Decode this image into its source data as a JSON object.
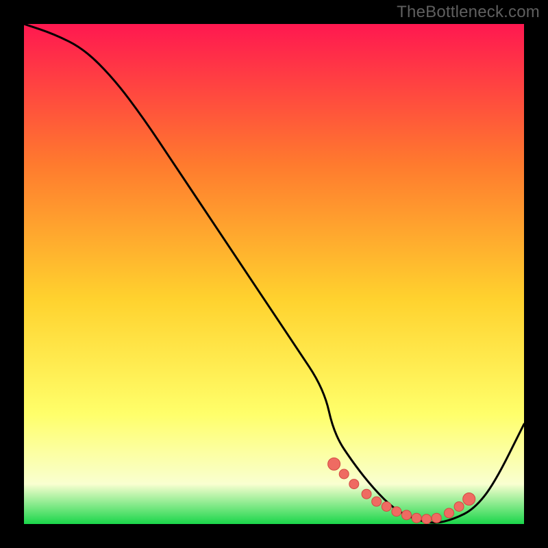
{
  "watermark": "TheBottleneck.com",
  "colors": {
    "bg_black": "#000000",
    "grad_top": "#ff1850",
    "grad_mid1": "#ff7a2e",
    "grad_mid2": "#ffd22e",
    "grad_light": "#ffff6a",
    "grad_pale": "#f9ffd0",
    "grad_green": "#1ad64a",
    "curve": "#000000",
    "marker_fill": "#ef6b62",
    "marker_stroke": "#d24a42"
  },
  "chart_data": {
    "type": "line",
    "title": "",
    "xlabel": "",
    "ylabel": "",
    "xlim": [
      0,
      100
    ],
    "ylim": [
      0,
      100
    ],
    "series": [
      {
        "name": "curve",
        "x": [
          0,
          6,
          12,
          18,
          24,
          30,
          36,
          42,
          48,
          54,
          60,
          62,
          66,
          70,
          74,
          78,
          82,
          86,
          90,
          94,
          100
        ],
        "y": [
          100,
          98,
          95,
          89,
          81,
          72,
          63,
          54,
          45,
          36,
          27,
          18,
          12,
          7,
          3,
          1,
          0,
          1,
          3,
          8,
          20
        ]
      }
    ],
    "markers": {
      "name": "trough-markers",
      "x": [
        62,
        64,
        66,
        68.5,
        70.5,
        72.5,
        74.5,
        76.5,
        78.5,
        80.5,
        82.5,
        85,
        87,
        89
      ],
      "y": [
        12,
        10,
        8,
        6,
        4.5,
        3.5,
        2.5,
        1.8,
        1.2,
        1,
        1.2,
        2.2,
        3.5,
        5
      ]
    }
  }
}
